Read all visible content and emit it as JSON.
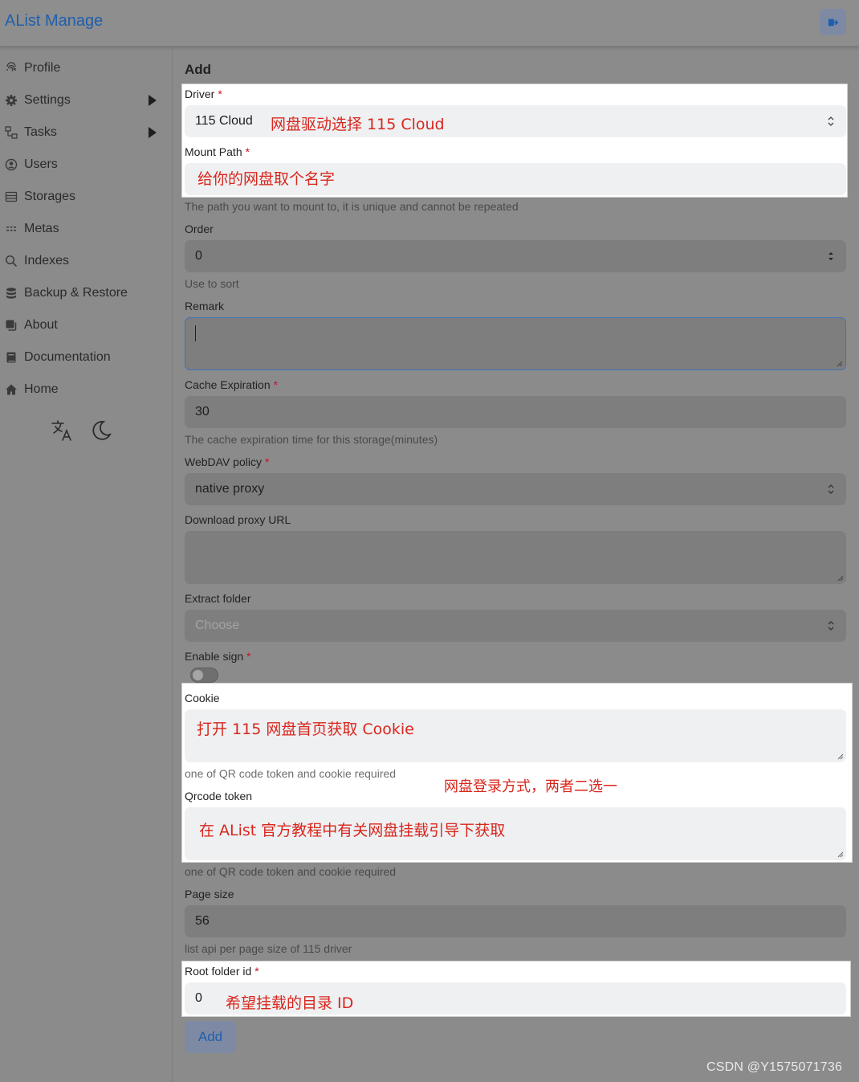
{
  "header": {
    "brand": "AList Manage",
    "logout_icon": "logout-icon"
  },
  "sidebar": {
    "items": [
      {
        "label": "Profile",
        "icon": "fingerprint-icon",
        "has_submenu": false
      },
      {
        "label": "Settings",
        "icon": "gear-icon",
        "has_submenu": true
      },
      {
        "label": "Tasks",
        "icon": "tasks-icon",
        "has_submenu": true
      },
      {
        "label": "Users",
        "icon": "user-circle-icon",
        "has_submenu": false
      },
      {
        "label": "Storages",
        "icon": "storage-icon",
        "has_submenu": false
      },
      {
        "label": "Metas",
        "icon": "metas-icon",
        "has_submenu": false
      },
      {
        "label": "Indexes",
        "icon": "search-icon",
        "has_submenu": false
      },
      {
        "label": "Backup & Restore",
        "icon": "database-icon",
        "has_submenu": false
      },
      {
        "label": "About",
        "icon": "copy-icon",
        "has_submenu": false
      },
      {
        "label": "Documentation",
        "icon": "book-icon",
        "has_submenu": false
      },
      {
        "label": "Home",
        "icon": "home-icon",
        "has_submenu": false
      }
    ],
    "tools": [
      "translate-icon",
      "moon-icon"
    ]
  },
  "form": {
    "heading": "Add",
    "required_mark": "*",
    "driver": {
      "label": "Driver",
      "value": "115 Cloud"
    },
    "mount_path": {
      "label": "Mount Path",
      "value": "",
      "hint": "The path you want to mount to, it is unique and cannot be repeated"
    },
    "order": {
      "label": "Order",
      "value": "0",
      "hint": "Use to sort"
    },
    "remark": {
      "label": "Remark",
      "value": ""
    },
    "cache_expiration": {
      "label": "Cache Expiration",
      "value": "30",
      "hint": "The cache expiration time for this storage(minutes)"
    },
    "webdav_policy": {
      "label": "WebDAV policy",
      "value": "native proxy"
    },
    "download_proxy_url": {
      "label": "Download proxy URL",
      "value": ""
    },
    "extract_folder": {
      "label": "Extract folder",
      "placeholder": "Choose"
    },
    "enable_sign": {
      "label": "Enable sign",
      "enabled": false
    },
    "cookie": {
      "label": "Cookie",
      "value": "",
      "hint": "one of QR code token and cookie required"
    },
    "qrcode_token": {
      "label": "Qrcode token",
      "value": "",
      "hint": "one of QR code token and cookie required"
    },
    "page_size": {
      "label": "Page size",
      "value": "56",
      "hint": "list api per page size of 115 driver"
    },
    "root_folder_id": {
      "label": "Root folder id",
      "value": "0"
    },
    "submit_label": "Add"
  },
  "annotations": {
    "driver": "网盘驱动选择 115 Cloud",
    "mount_path": "给你的网盘取个名字",
    "cookie": "打开 115 网盘首页获取 Cookie",
    "login_method": "网盘登录方式，两者二选一",
    "qrcode": "在 AList 官方教程中有关网盘挂载引导下获取",
    "root_folder": "希望挂载的目录 ID",
    "color": "#d9261c"
  },
  "watermark": "CSDN @Y1575071736",
  "colors": {
    "brand": "#1f5fae",
    "required": "#c8102e",
    "annotation": "#d9261c"
  }
}
